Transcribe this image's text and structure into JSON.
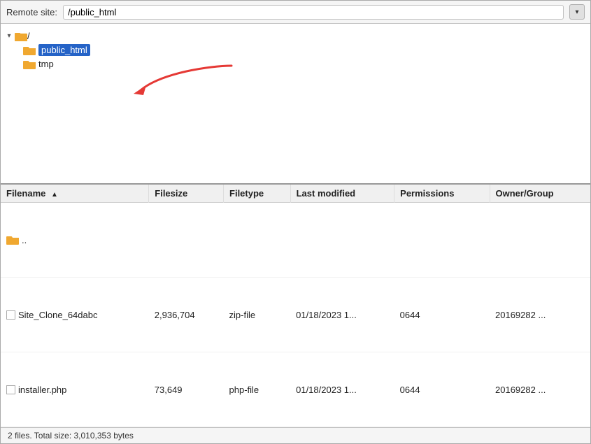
{
  "remote_site": {
    "label": "Remote site:",
    "path": "/public_html",
    "dropdown_icon": "▾"
  },
  "tree": {
    "items": [
      {
        "id": "root",
        "label": "/",
        "indent": 0,
        "toggle": "▾",
        "has_toggle": true,
        "folder": true,
        "selected": false
      },
      {
        "id": "public_html",
        "label": "public_html",
        "indent": 1,
        "toggle": "",
        "has_toggle": false,
        "folder": true,
        "selected": true
      },
      {
        "id": "tmp",
        "label": "tmp",
        "indent": 1,
        "toggle": "",
        "has_toggle": false,
        "folder": true,
        "selected": false
      }
    ]
  },
  "file_table": {
    "columns": [
      {
        "id": "filename",
        "label": "Filename",
        "sort_indicator": "▲"
      },
      {
        "id": "filesize",
        "label": "Filesize"
      },
      {
        "id": "filetype",
        "label": "Filetype"
      },
      {
        "id": "last_modified",
        "label": "Last modified"
      },
      {
        "id": "permissions",
        "label": "Permissions"
      },
      {
        "id": "owner_group",
        "label": "Owner/Group"
      }
    ],
    "rows": [
      {
        "filename": "..",
        "filesize": "",
        "filetype": "",
        "last_modified": "",
        "permissions": "",
        "owner_group": "",
        "is_folder": true,
        "is_parent": true
      },
      {
        "filename": "Site_Clone_64dabc",
        "filesize": "2,936,704",
        "filetype": "zip-file",
        "last_modified": "01/18/2023 1...",
        "permissions": "0644",
        "owner_group": "20169282 ...",
        "is_folder": false,
        "is_parent": false
      },
      {
        "filename": "installer.php",
        "filesize": "73,649",
        "filetype": "php-file",
        "last_modified": "01/18/2023 1...",
        "permissions": "0644",
        "owner_group": "20169282 ...",
        "is_folder": false,
        "is_parent": false
      }
    ]
  },
  "status_bar": {
    "text": "2 files. Total size: 3,010,353 bytes"
  }
}
